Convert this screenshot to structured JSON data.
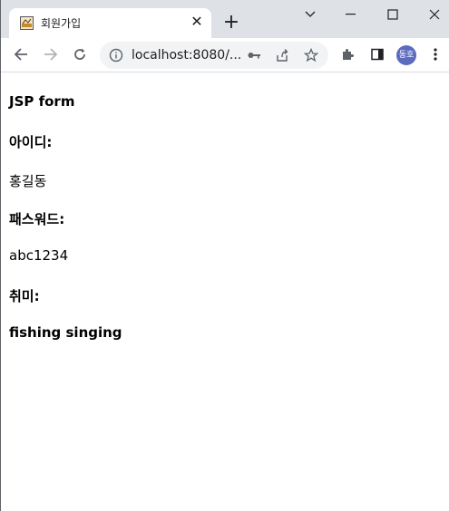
{
  "browser": {
    "tab": {
      "title": "회원가입",
      "favicon": "page-favicon"
    },
    "omnibox": {
      "url": "localhost:8080/..."
    },
    "profile": {
      "initials": "동호"
    }
  },
  "page": {
    "heading": "JSP form",
    "id_label": "아이디:",
    "id_value": "홍길동",
    "password_label": "패스워드:",
    "password_value": "abc1234",
    "hobby_label": "취미:",
    "hobby_value": "fishing singing"
  }
}
